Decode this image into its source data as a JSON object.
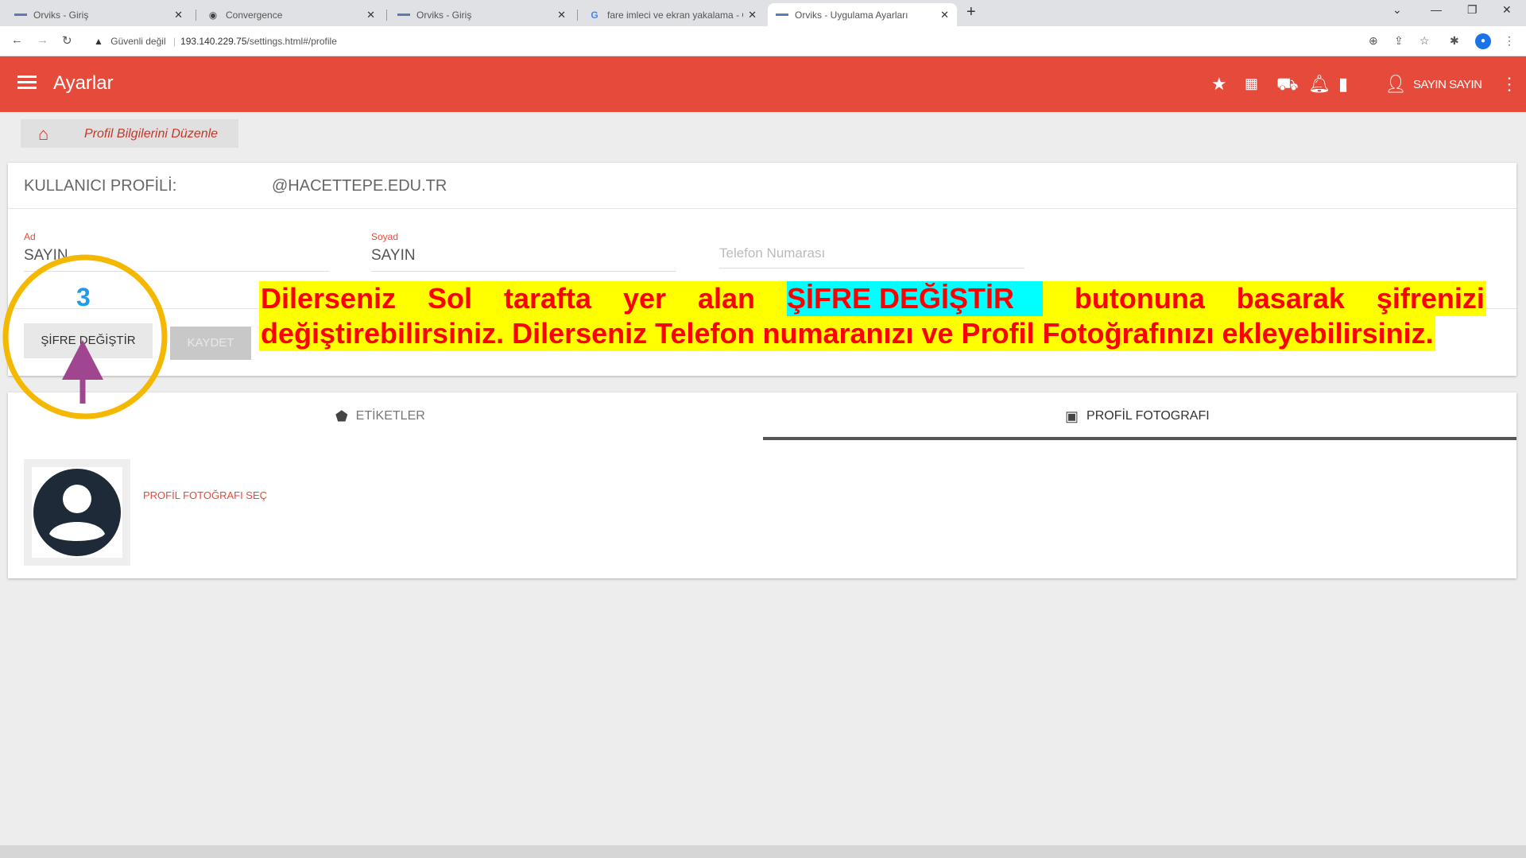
{
  "browser": {
    "tabs": [
      {
        "title": "Orviks - Giriş",
        "active": false
      },
      {
        "title": "Convergence",
        "active": false
      },
      {
        "title": "Orviks - Giriş",
        "active": false
      },
      {
        "title": "fare imleci ve ekran yakalama - G",
        "active": false
      },
      {
        "title": "Orviks - Uygulama Ayarları",
        "active": true
      }
    ],
    "security_label": "Güvenli değil",
    "url_host": "193.140.229.75",
    "url_path": "/settings.html#/profile"
  },
  "app": {
    "title": "Ayarlar",
    "user_name": "SAYIN SAYIN",
    "accent_color": "#e64a3b",
    "icons": [
      "star-icon",
      "apps-grid-icon",
      "inbox-icon",
      "bell-icon",
      "briefcase-icon",
      "person-icon",
      "more-vert-icon"
    ]
  },
  "breadcrumb": {
    "label": "Profil Bilgilerini Düzenle"
  },
  "profile": {
    "label": "KULLANICI PROFİLİ:",
    "value": "@HACETTEPE.EDU.TR",
    "first_name_label": "Ad",
    "first_name": "SAYIN",
    "last_name_label": "Soyad",
    "last_name": "SAYIN",
    "phone_placeholder": "Telefon Numarası",
    "change_password_button": "ŞİFRE DEĞİŞTİR",
    "save_button": "KAYDET"
  },
  "tabs": {
    "labels_tab": "ETİKETLER",
    "photo_tab": "PROFİL FOTOGRAFI",
    "choose_photo": "PROFİL FOTOĞRAFI SEÇ"
  },
  "annotation": {
    "step": "3",
    "line1_words": [
      "Dilerseniz",
      "Sol",
      "tarafta",
      "yer",
      "alan"
    ],
    "highlight": "ŞİFRE DEĞİŞTİR",
    "line1_tail": [
      "butonuna",
      "basarak",
      "şifrenizi"
    ],
    "line2": "değiştirebilirsiniz.  Dilerseniz Telefon numaranızı ve Profil Fotoğrafınızı ekleyebilirsiniz.",
    "circle_color": "#f5b800",
    "arrow_color": "#a0458f"
  }
}
